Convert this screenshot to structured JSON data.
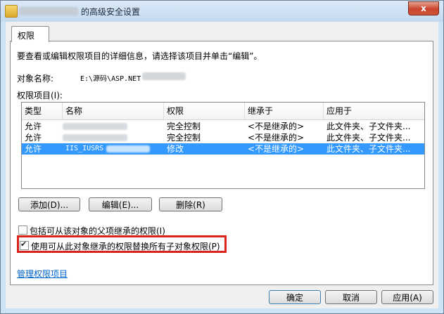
{
  "window": {
    "title": "的高级安全设置",
    "close_label": "x"
  },
  "tab": {
    "label": "权限"
  },
  "intro": "要查看或编辑权限项目的详细信息，请选择该项目并单击“编辑”。",
  "object": {
    "label": "对象名称:",
    "value": "E:\\源码\\ASP.NET"
  },
  "permissions": {
    "label": "权限项目(I):",
    "columns": [
      "类型",
      "名称",
      "权限",
      "继承于",
      "应用于"
    ],
    "rows": [
      {
        "type": "允许",
        "name": "",
        "perm": "完全控制",
        "inherit": "<不是继承的>",
        "apply": "此文件夹、子文件夹..."
      },
      {
        "type": "允许",
        "name": "",
        "perm": "完全控制",
        "inherit": "<不是继承的>",
        "apply": "此文件夹、子文件夹..."
      },
      {
        "type": "允许",
        "name": "IIS_IUSRS",
        "perm": "修改",
        "inherit": "<不是继承的>",
        "apply": "此文件夹、子文件夹..."
      }
    ]
  },
  "buttons": {
    "add": "添加(D)...",
    "edit": "编辑(E)...",
    "delete": "删除(R)"
  },
  "options": {
    "include_inherit": "包括可从该对象的父项继承的权限(I)",
    "replace_child": "使用可从此对象继承的权限替换所有子对象权限(P)"
  },
  "link": "管理权限项目",
  "footer": {
    "ok": "确定",
    "cancel": "取消",
    "apply": "应用(A)"
  }
}
